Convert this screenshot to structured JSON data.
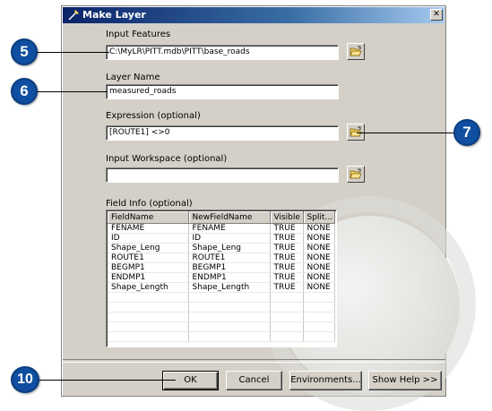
{
  "window": {
    "title": "Make Layer"
  },
  "fields": {
    "input_features": {
      "label": "Input Features",
      "value": "C:\\MyLR\\PITT.mdb\\PITT\\base_roads"
    },
    "layer_name": {
      "label": "Layer Name",
      "value": "measured_roads"
    },
    "expression": {
      "label": "Expression (optional)",
      "value": "[ROUTE1] <>0"
    },
    "input_workspace": {
      "label": "Input Workspace (optional)",
      "value": ""
    },
    "field_info": {
      "label": "Field Info (optional)"
    }
  },
  "field_table": {
    "headers": [
      "FieldName",
      "NewFieldName",
      "Visible",
      "Split..."
    ],
    "rows": [
      [
        "FENAME",
        "FENAME",
        "TRUE",
        "NONE"
      ],
      [
        "ID",
        "ID",
        "TRUE",
        "NONE"
      ],
      [
        "Shape_Leng",
        "Shape_Leng",
        "TRUE",
        "NONE"
      ],
      [
        "ROUTE1",
        "ROUTE1",
        "TRUE",
        "NONE"
      ],
      [
        "BEGMP1",
        "BEGMP1",
        "TRUE",
        "NONE"
      ],
      [
        "ENDMP1",
        "ENDMP1",
        "TRUE",
        "NONE"
      ],
      [
        "Shape_Length",
        "Shape_Length",
        "TRUE",
        "NONE"
      ]
    ]
  },
  "buttons": {
    "ok": "OK",
    "cancel": "Cancel",
    "environments": "Environments...",
    "show_help": "Show Help >>"
  },
  "callouts": {
    "c5": "5",
    "c6": "6",
    "c7": "7",
    "c10": "10"
  },
  "icons": {
    "browse": "folder-open-icon",
    "title": "tool-icon",
    "close": "close-icon"
  },
  "colors": {
    "titlebar": "#0a246a",
    "callout": "#0f4ea0",
    "dialog": "#d4d0c8"
  }
}
